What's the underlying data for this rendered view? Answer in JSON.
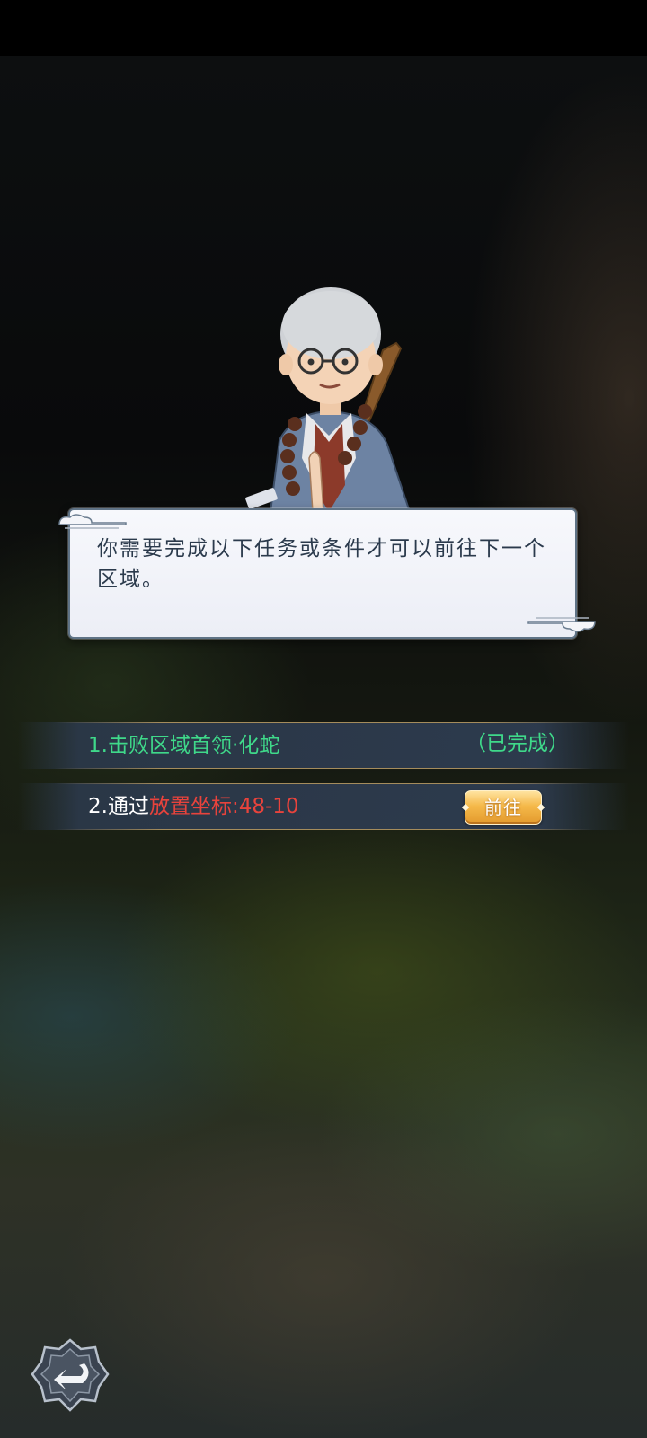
{
  "dialog": {
    "text": "你需要完成以下任务或条件才可以前往下一个区域。"
  },
  "tasks": [
    {
      "label": "1.击败区域首领·化蛇",
      "status": "（已完成）",
      "color": "#3fd98a"
    },
    {
      "prefix": "2.通过",
      "highlight": "放置坐标:48-10",
      "button_label": "前往",
      "prefix_color": "#ffffff",
      "highlight_color": "#e8433c"
    }
  ],
  "icons": {
    "back": "back-arrow-icon",
    "cloud": "cloud-ornament-icon"
  }
}
